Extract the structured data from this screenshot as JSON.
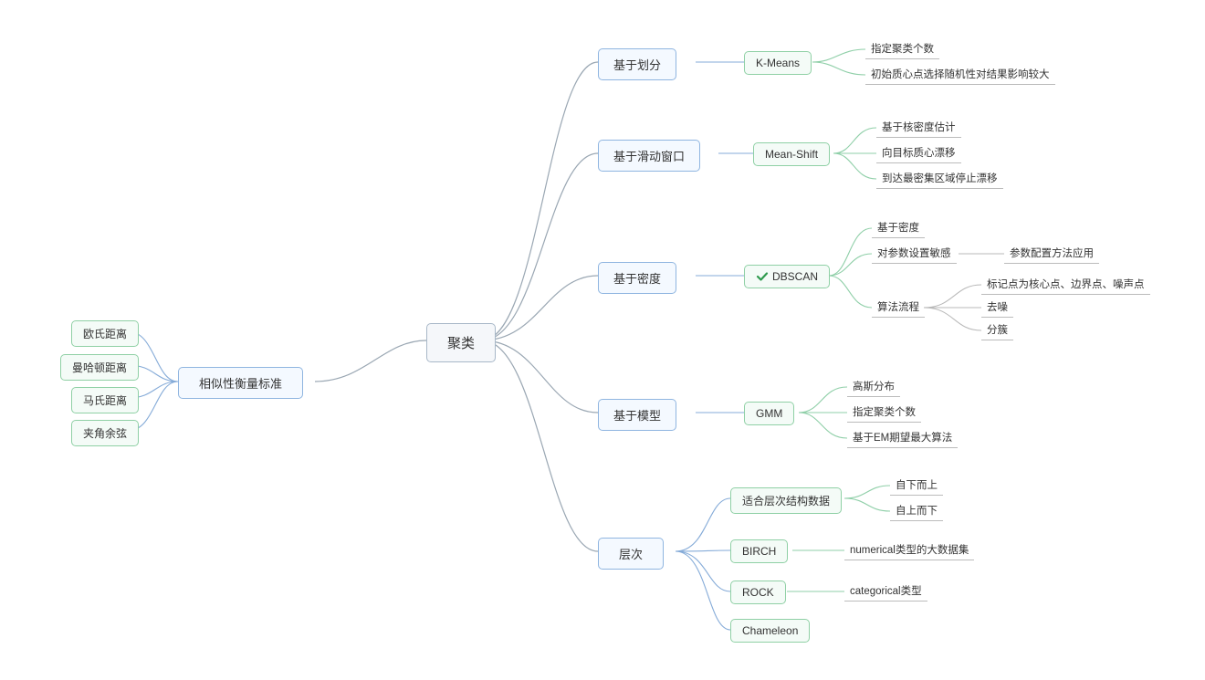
{
  "root": "聚类",
  "left_branch": {
    "label": "相似性衡量标准",
    "items": [
      "欧氏距离",
      "曼哈顿距离",
      "马氏距离",
      "夹角余弦"
    ]
  },
  "right": [
    {
      "label": "基于划分",
      "algo": "K-Means",
      "notes": [
        "指定聚类个数",
        "初始质心点选择随机性对结果影响较大"
      ]
    },
    {
      "label": "基于滑动窗口",
      "algo": "Mean-Shift",
      "notes": [
        "基于核密度估计",
        "向目标质心漂移",
        "到达最密集区域停止漂移"
      ]
    },
    {
      "label": "基于密度",
      "algo": "DBSCAN",
      "checked": true,
      "notes": [
        "基于密度"
      ],
      "sensitive": {
        "label": "对参数设置敏感",
        "child": "参数配置方法应用"
      },
      "flow": {
        "label": "算法流程",
        "children": [
          "标记点为核心点、边界点、噪声点",
          "去噪",
          "分簇"
        ]
      }
    },
    {
      "label": "基于模型",
      "algo": "GMM",
      "notes": [
        "高斯分布",
        "指定聚类个数",
        "基于EM期望最大算法"
      ]
    },
    {
      "label": "层次",
      "subs": [
        {
          "label": "适合层次结构数据",
          "children": [
            "自下而上",
            "自上而下"
          ]
        },
        {
          "label": "BIRCH",
          "note": "numerical类型的大数据集"
        },
        {
          "label": "ROCK",
          "note": "categorical类型"
        },
        {
          "label": "Chameleon"
        }
      ]
    }
  ]
}
